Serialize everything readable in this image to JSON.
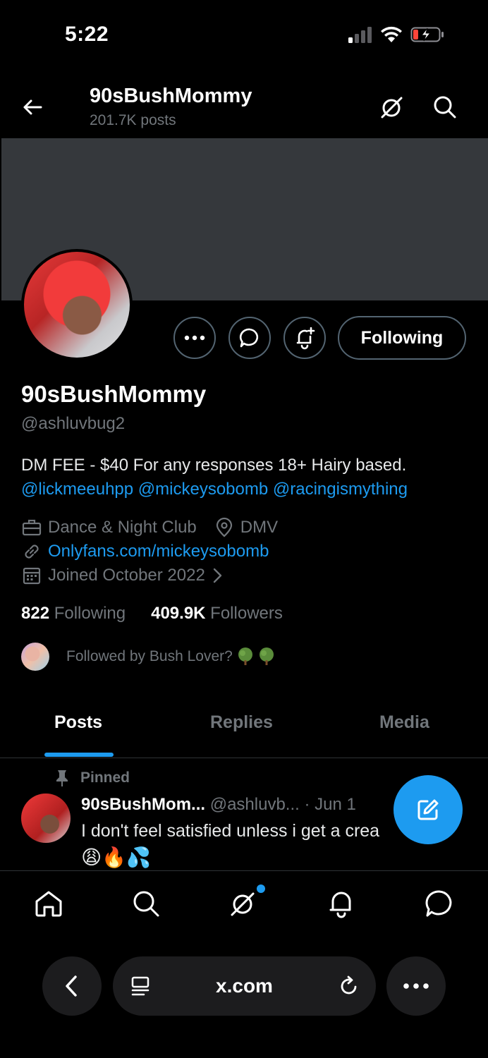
{
  "status_bar": {
    "time": "5:22"
  },
  "header": {
    "title": "90sBushMommy",
    "post_count": "201.7K posts"
  },
  "profile": {
    "follow_button_label": "Following",
    "display_name": "90sBushMommy",
    "handle": "@ashluvbug2",
    "bio": "DM FEE - $40 For any responses 18+ Hairy based.",
    "bio_mentions": [
      "@lickmeeuhpp",
      "@mickeysobomb",
      "@racingismything"
    ],
    "category": "Dance & Night Club",
    "location": "DMV",
    "link": "Onlyfans.com/mickeysobomb",
    "joined": "Joined October 2022",
    "following_count": "822",
    "following_label": "Following",
    "followers_count": "409.9K",
    "followers_label": "Followers",
    "followed_by": "Followed by Bush Lover?"
  },
  "tabs": [
    {
      "label": "Posts",
      "active": true
    },
    {
      "label": "Replies",
      "active": false
    },
    {
      "label": "Media",
      "active": false
    }
  ],
  "pinned_post": {
    "pinned_label": "Pinned",
    "author_name": "90sBushMom...",
    "author_handle": "@ashluvb...",
    "date": "· Jun 1",
    "text": "I don't feel satisfied unless i get a crea",
    "emojis": "😩🔥💦"
  },
  "browser": {
    "url": "x.com"
  },
  "colors": {
    "accent": "#1d9bf0",
    "muted": "#71767b",
    "background": "#000000",
    "banner": "#35383c"
  }
}
